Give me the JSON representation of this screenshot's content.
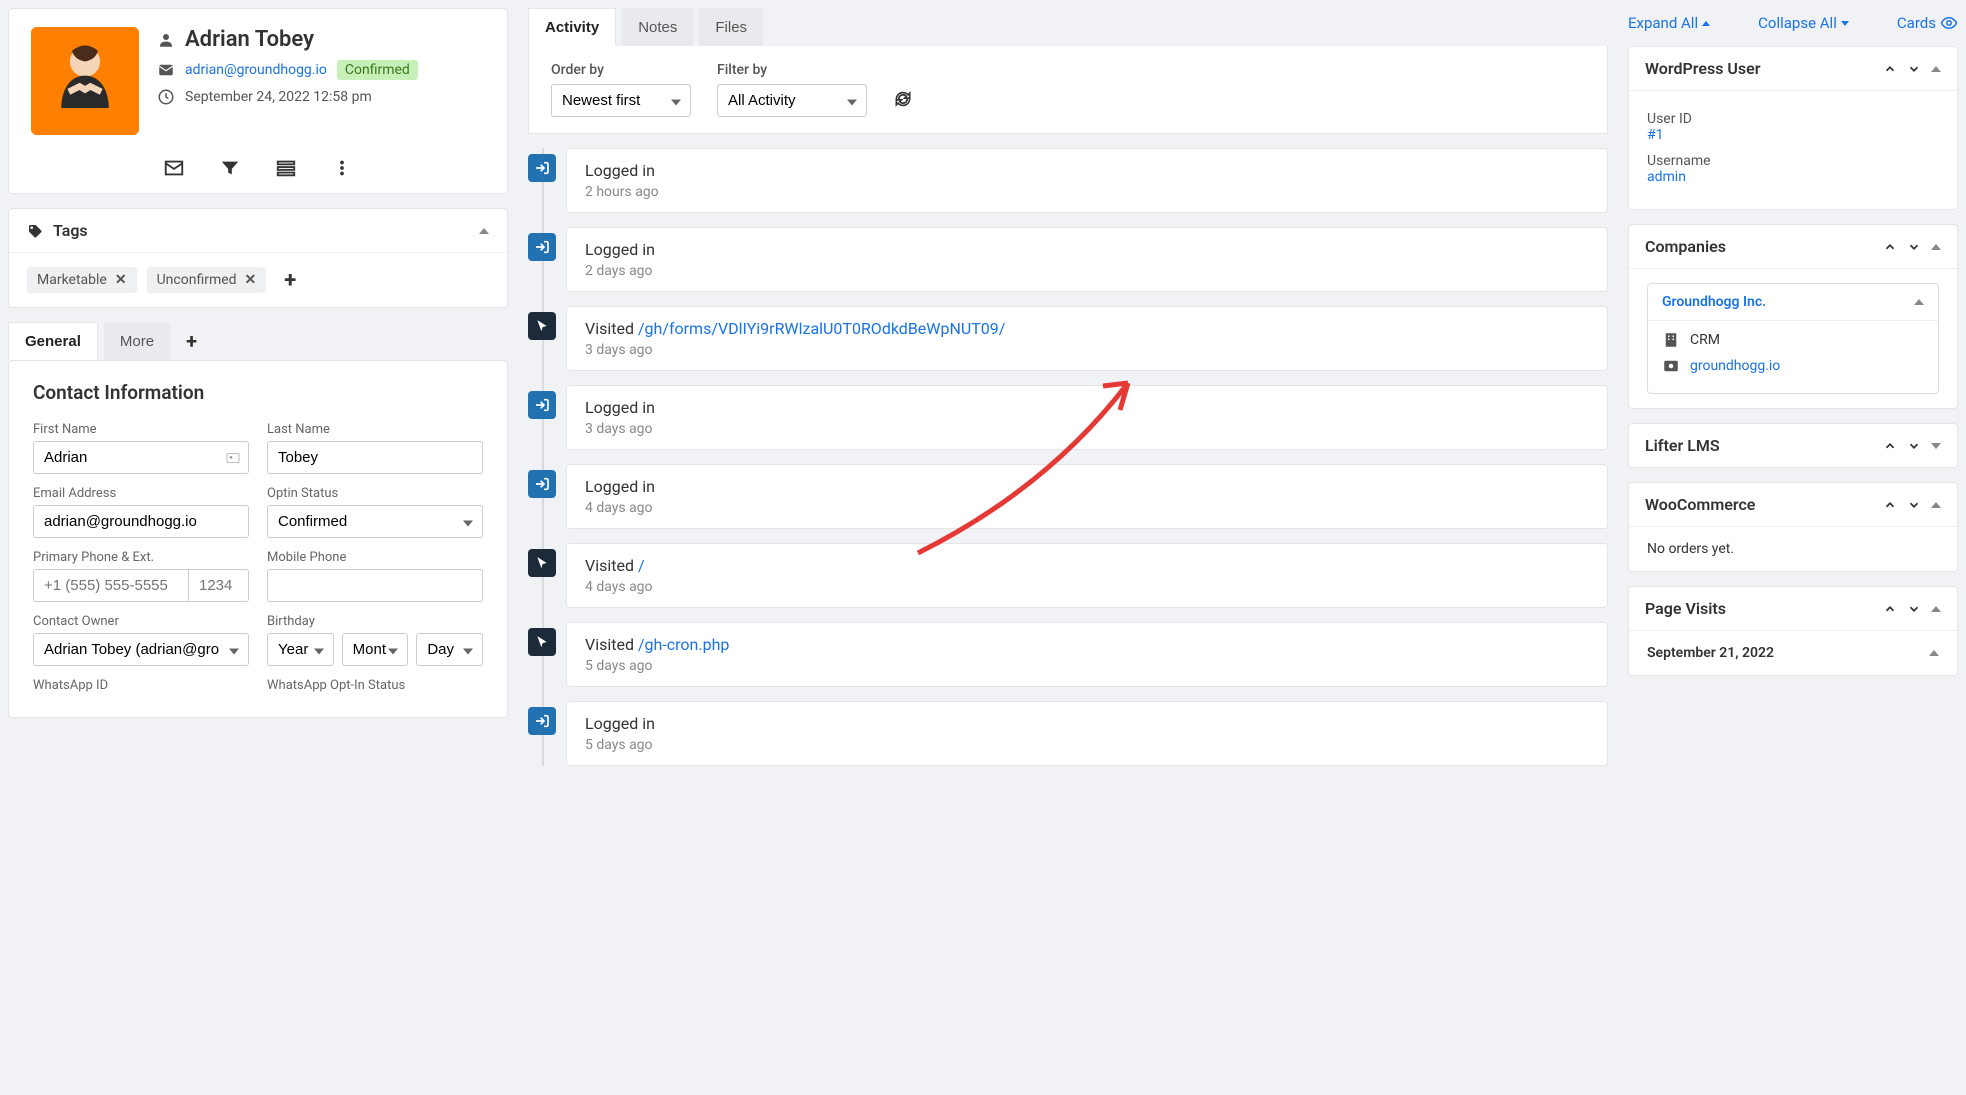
{
  "profile": {
    "name": "Adrian Tobey",
    "email": "adrian@groundhogg.io",
    "status": "Confirmed",
    "date": "September 24, 2022 12:58 pm"
  },
  "tags": {
    "title": "Tags",
    "items": [
      "Marketable",
      "Unconfirmed"
    ]
  },
  "leftTabs": {
    "general": "General",
    "more": "More"
  },
  "contactForm": {
    "title": "Contact Information",
    "firstNameLabel": "First Name",
    "firstName": "Adrian",
    "lastNameLabel": "Last Name",
    "lastName": "Tobey",
    "emailLabel": "Email Address",
    "email": "adrian@groundhogg.io",
    "optinLabel": "Optin Status",
    "optin": "Confirmed",
    "phoneLabel": "Primary Phone & Ext.",
    "phonePlaceholder": "+1 (555) 555-5555",
    "extPlaceholder": "1234",
    "mobileLabel": "Mobile Phone",
    "ownerLabel": "Contact Owner",
    "owner": "Adrian Tobey (adrian@gro",
    "birthdayLabel": "Birthday",
    "year": "Year",
    "month": "Mont",
    "day": "Day",
    "whatsappLabel": "WhatsApp ID",
    "whatsappOptLabel": "WhatsApp Opt-In Status"
  },
  "midTabs": {
    "activity": "Activity",
    "notes": "Notes",
    "files": "Files"
  },
  "filters": {
    "orderLabel": "Order by",
    "orderValue": "Newest first",
    "filterLabel": "Filter by",
    "filterValue": "All Activity"
  },
  "timeline": [
    {
      "type": "login",
      "title": "Logged in",
      "time": "2 hours ago"
    },
    {
      "type": "login",
      "title": "Logged in",
      "time": "2 days ago"
    },
    {
      "type": "visit",
      "prefix": "Visited ",
      "link": "/gh/forms/VDlIYi9rRWlzalU0T0ROdkdBeWpNUT09/",
      "time": "3 days ago"
    },
    {
      "type": "login",
      "title": "Logged in",
      "time": "3 days ago"
    },
    {
      "type": "login",
      "title": "Logged in",
      "time": "4 days ago"
    },
    {
      "type": "visit",
      "prefix": "Visited ",
      "link": "/",
      "time": "4 days ago"
    },
    {
      "type": "visit",
      "prefix": "Visited ",
      "link": "/gh-cron.php",
      "time": "5 days ago"
    },
    {
      "type": "login",
      "title": "Logged in",
      "time": "5 days ago"
    }
  ],
  "rightControls": {
    "expand": "Expand All",
    "collapse": "Collapse All",
    "cards": "Cards"
  },
  "wpUser": {
    "title": "WordPress User",
    "idLabel": "User ID",
    "idValue": "#1",
    "usernameLabel": "Username",
    "usernameValue": "admin"
  },
  "companies": {
    "title": "Companies",
    "name": "Groundhogg Inc.",
    "category": "CRM",
    "website": "groundhogg.io"
  },
  "lifter": {
    "title": "Lifter LMS"
  },
  "woo": {
    "title": "WooCommerce",
    "empty": "No orders yet."
  },
  "pageVisits": {
    "title": "Page Visits",
    "date": "September 21, 2022"
  }
}
